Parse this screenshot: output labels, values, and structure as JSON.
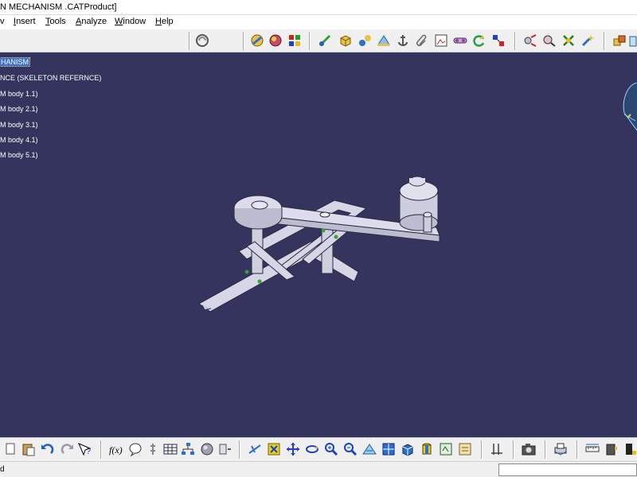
{
  "title": "N MECHANISM .CATProduct]",
  "menu": [
    {
      "label": "Insert",
      "u": "I",
      "rest": "nsert"
    },
    {
      "label": "Tools",
      "u": "T",
      "rest": "ools"
    },
    {
      "label": "Analyze",
      "u": "A",
      "rest": "nalyze"
    },
    {
      "label": "Window",
      "u": "W",
      "rest": "indow"
    },
    {
      "label": "Help",
      "u": "H",
      "rest": "elp"
    }
  ],
  "menu_partial": "v",
  "tree": {
    "root": "HANISM",
    "items": [
      "NCE (SKELETON REFERNCE)",
      "M body 1.1)",
      "M body 2.1)",
      "M body 3.1)",
      "M body 4.1)",
      "M body 5.1)"
    ]
  },
  "status": {
    "text": "d",
    "input_value": ""
  },
  "colors": {
    "viewport_bg": "#34345e",
    "selection": "#3d6fd0",
    "part_fill": "#d6d6e6",
    "part_edge": "#2a2a40"
  },
  "toolbar_top_icons": [
    "selection-cycle-icon",
    "product-icon",
    "material-icon",
    "color-icon",
    "scene-icon",
    "part-icon",
    "compass-icon",
    "catalog-icon",
    "anchor-icon",
    "paperclip-icon",
    "snapshot-icon",
    "fix-together-icon",
    "refresh-icon",
    "constraint-icon",
    "explode-icon",
    "snap-icon",
    "clash-icon",
    "wand-icon",
    "assembly-icon"
  ],
  "toolbar_bottom_icons": [
    "paste-icon",
    "undo-icon",
    "redo-icon",
    "whats-this-icon",
    "formula-icon",
    "comment-icon",
    "knowledge-icon",
    "table-icon",
    "tree-icon",
    "sphere-icon",
    "shape-icon",
    "fly-icon",
    "fit-all-icon",
    "pan-icon",
    "rotate-icon",
    "zoom-in-icon",
    "zoom-out-icon",
    "normal-view-icon",
    "iso-view-icon",
    "cube-view-icon",
    "render-icon",
    "hide-show-icon",
    "swap-icon",
    "measure-icon",
    "capture-icon",
    "print-icon",
    "ruler-icon",
    "tools-icon",
    "phone-icon"
  ]
}
